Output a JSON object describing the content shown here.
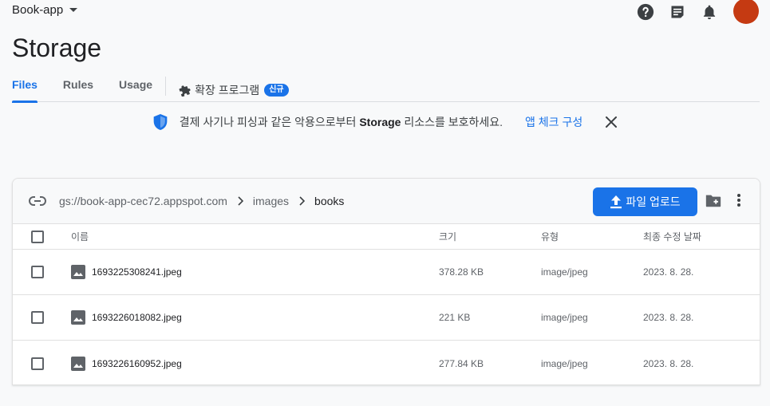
{
  "header": {
    "project_name": "Book-app",
    "icons": [
      "help-icon",
      "feedback-icon",
      "notifications-icon"
    ],
    "avatar_color": "#c53a12"
  },
  "page": {
    "title": "Storage"
  },
  "tabs": {
    "items": [
      {
        "label": "Files",
        "active": true
      },
      {
        "label": "Rules",
        "active": false
      },
      {
        "label": "Usage",
        "active": false
      }
    ],
    "extensions": {
      "label": "확장 프로그램",
      "badge": "신규"
    }
  },
  "banner": {
    "message_pre": "결제 사기나 피싱과 같은 악용으로부터 ",
    "message_bold": "Storage",
    "message_post": " 리소스를 보호하세요.",
    "link": "앱 체크 구성"
  },
  "browser": {
    "breadcrumb": [
      "gs://book-app-cec72.appspot.com",
      "images",
      "books"
    ],
    "upload_label": "파일 업로드",
    "columns": {
      "name": "이름",
      "size": "크기",
      "type": "유형",
      "modified": "최종 수정 날짜"
    },
    "files": [
      {
        "name": "1693225308241.jpeg",
        "size": "378.28 KB",
        "type": "image/jpeg",
        "modified": "2023. 8. 28."
      },
      {
        "name": "1693226018082.jpeg",
        "size": "221 KB",
        "type": "image/jpeg",
        "modified": "2023. 8. 28."
      },
      {
        "name": "1693226160952.jpeg",
        "size": "277.84 KB",
        "type": "image/jpeg",
        "modified": "2023. 8. 28."
      }
    ]
  },
  "colors": {
    "accent": "#1a73e8",
    "icon": "#3c4043",
    "shield": "#1a73e8"
  }
}
